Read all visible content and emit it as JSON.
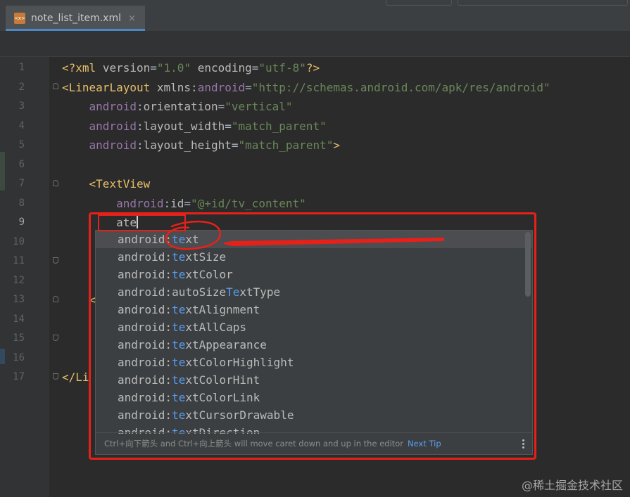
{
  "tab": {
    "icon_text": "<x>",
    "name": "note_list_item.xml",
    "close": "×"
  },
  "line_numbers": [
    "1",
    "2",
    "3",
    "4",
    "5",
    "6",
    "7",
    "8",
    "9",
    "10",
    "11",
    "12",
    "13",
    "14",
    "15",
    "16",
    "17"
  ],
  "code": {
    "l1": {
      "open": "<?",
      "tag": "xml",
      "a1": "version",
      "v1": "\"1.0\"",
      "a2": "encoding",
      "v2": "\"utf-8\"",
      "close": "?>"
    },
    "l2": {
      "open": "<",
      "tag": "LinearLayout",
      "a1": "xmlns",
      "ns": "android",
      "v1": "\"http://schemas.android.com/apk/res/android\""
    },
    "l3": {
      "ns": "android",
      "attr": "orientation",
      "val": "\"vertical\""
    },
    "l4": {
      "ns": "android",
      "attr": "layout_width",
      "val": "\"match_parent\""
    },
    "l5": {
      "ns": "android",
      "attr": "layout_height",
      "val": "\"match_parent\"",
      "close": ">"
    },
    "l7": {
      "open": "<",
      "tag": "TextView"
    },
    "l8": {
      "ns": "android",
      "attr": "id",
      "val": "\"@+id/tv_content\""
    },
    "l9": {
      "typed": "ate"
    },
    "l13": {
      "frag": "<"
    },
    "l17": {
      "open": "</",
      "tag": "Li"
    }
  },
  "completion": {
    "items": [
      {
        "ns": "android:",
        "pre": "",
        "m": "te",
        "post": "xt"
      },
      {
        "ns": "android:",
        "pre": "",
        "m": "te",
        "post": "xtSize"
      },
      {
        "ns": "android:",
        "pre": "",
        "m": "te",
        "post": "xtColor"
      },
      {
        "ns": "android:",
        "pre": "autoSize",
        "m": "Te",
        "post": "xtType"
      },
      {
        "ns": "android:",
        "pre": "",
        "m": "te",
        "post": "xtAlignment"
      },
      {
        "ns": "android:",
        "pre": "",
        "m": "te",
        "post": "xtAllCaps"
      },
      {
        "ns": "android:",
        "pre": "",
        "m": "te",
        "post": "xtAppearance"
      },
      {
        "ns": "android:",
        "pre": "",
        "m": "te",
        "post": "xtColorHighlight"
      },
      {
        "ns": "android:",
        "pre": "",
        "m": "te",
        "post": "xtColorHint"
      },
      {
        "ns": "android:",
        "pre": "",
        "m": "te",
        "post": "xtColorLink"
      },
      {
        "ns": "android:",
        "pre": "",
        "m": "te",
        "post": "xtCursorDrawable"
      },
      {
        "ns": "android:",
        "pre": "",
        "m": "te",
        "post": "xtDirection"
      }
    ],
    "hint": "Ctrl+向下箭头 and Ctrl+向上箭头 will move caret down and up in the editor",
    "next_tip": "Next Tip"
  },
  "watermark": "@稀土掘金技术社区",
  "colors": {
    "editor_bg": "#2b2b2b",
    "tag": "#e8bf6a",
    "namespace": "#9876aa",
    "string": "#6a8759",
    "match": "#589df6",
    "annotation": "#e8201a"
  }
}
